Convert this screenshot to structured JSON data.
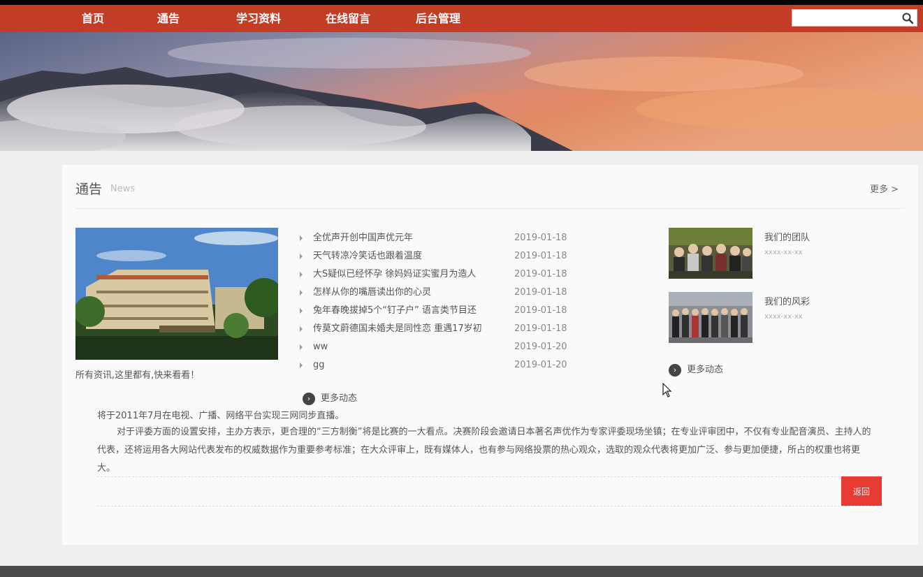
{
  "nav": {
    "items": [
      {
        "label": "首页"
      },
      {
        "label": "通告"
      },
      {
        "label": "学习资料"
      },
      {
        "label": "在线留言"
      },
      {
        "label": "后台管理"
      }
    ],
    "search": {
      "value": "",
      "placeholder": ""
    }
  },
  "banner": {
    "slide_count": 5,
    "active_slide": 1
  },
  "news_section": {
    "title": "通告",
    "subtitle": "News",
    "more": "更多 >",
    "feature_caption": "所有资讯,这里都有,快来看看！",
    "items": [
      {
        "title": "全优声开创中国声优元年",
        "date": "2019-01-18"
      },
      {
        "title": "天气转凉冷笑话也跟着温度",
        "date": "2019-01-18"
      },
      {
        "title": "大S疑似已经怀孕 徐妈妈证实蜜月为造人",
        "date": "2019-01-18"
      },
      {
        "title": "怎样从你的嘴唇读出你的心灵",
        "date": "2019-01-18"
      },
      {
        "title": "兔年春晚拔掉5个“钉子户” 语言类节目还",
        "date": "2019-01-18"
      },
      {
        "title": "传莫文蔚德国未婚夫是同性恋 重遇17岁初",
        "date": "2019-01-18"
      },
      {
        "title": "ww",
        "date": "2019-01-20"
      },
      {
        "title": "gg",
        "date": "2019-01-20"
      }
    ],
    "more_dynamic": "更多动态",
    "side_cards": [
      {
        "title": "我们的团队",
        "date": "xxxx-xx-xx"
      },
      {
        "title": "我们的风彩",
        "date": "xxxx-xx-xx"
      }
    ],
    "side_more_dynamic": "更多动态"
  },
  "article": {
    "line1": "将于2011年7月在电视、广播、网络平台实现三网同步直播。",
    "paragraph": "对于评委方面的设置安排，主办方表示，更合理的“三方制衡”将是比赛的一大看点。决赛阶段会邀请日本著名声优作为专家评委现场坐镇；在专业评审团中，不仅有专业配音演员、主持人的代表，还将运用各大网站代表发布的权威数据作为重要参考标准；在大众评审上，既有媒体人，也有参与网络投票的热心观众，选取的观众代表将更加广泛、参与更加便捷，所占的权重也将更大。",
    "back_button": "返回"
  },
  "colors": {
    "nav_bg": "#c23c26",
    "accent_red": "#e83b33",
    "active_dot": "#e0522e"
  }
}
